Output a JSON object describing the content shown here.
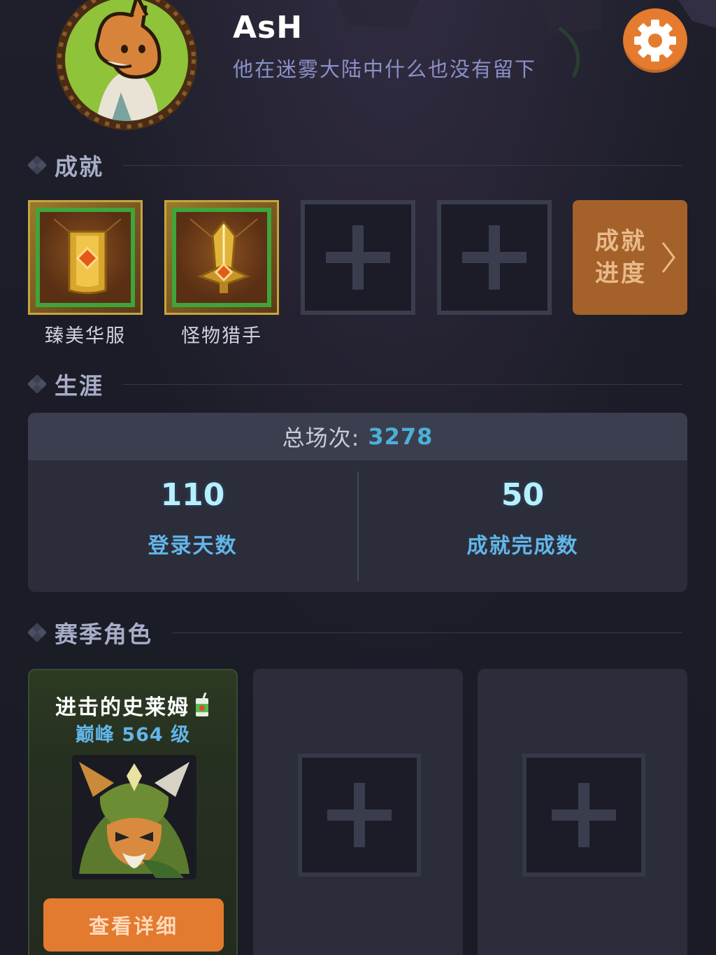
{
  "profile": {
    "name": "AsH",
    "bio": "他在迷雾大陆中什么也没有留下"
  },
  "sections": {
    "achievements": "成就",
    "career": "生涯",
    "season_roles": "赛季角色"
  },
  "achievements": {
    "items": [
      {
        "label": "臻美华服",
        "icon": "golden-armor-badge-icon"
      },
      {
        "label": "怪物猎手",
        "icon": "golden-sword-badge-icon"
      }
    ],
    "empty_slots": 2,
    "progress_button": "成就进度"
  },
  "career": {
    "total_label": "总场次:",
    "total_value": "3278",
    "stats": [
      {
        "value": "110",
        "label": "登录天数"
      },
      {
        "value": "50",
        "label": "成就完成数"
      }
    ]
  },
  "season_roles": {
    "filled": {
      "name": "进击的史莱姆",
      "level": "巅峰 564 级",
      "detail_button": "查看详细"
    },
    "empty_slots": 2
  },
  "colors": {
    "background": "#1c1d28",
    "accent_orange": "#e57b2e",
    "stat_blue": "#62b6e8",
    "total_blue": "#4bb0d8",
    "achievement_border_green": "#3fa53a"
  }
}
